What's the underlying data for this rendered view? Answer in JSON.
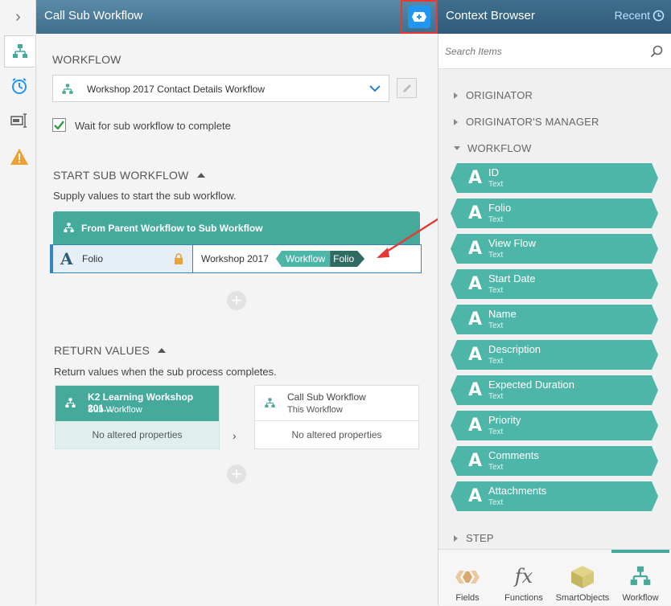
{
  "header": {
    "title": "Call Sub Workflow"
  },
  "context_browser": {
    "title": "Context Browser",
    "recent_label": "Recent",
    "search_placeholder": "Search Items",
    "sections": {
      "originator": "ORIGINATOR",
      "originators_manager": "ORIGINATOR'S MANAGER",
      "workflow": "WORKFLOW",
      "step": "STEP"
    },
    "items": [
      {
        "name": "ID",
        "type": "Text"
      },
      {
        "name": "Folio",
        "type": "Text"
      },
      {
        "name": "View Flow",
        "type": "Text"
      },
      {
        "name": "Start Date",
        "type": "Text"
      },
      {
        "name": "Name",
        "type": "Text"
      },
      {
        "name": "Description",
        "type": "Text"
      },
      {
        "name": "Expected Duration",
        "type": "Text"
      },
      {
        "name": "Priority",
        "type": "Text"
      },
      {
        "name": "Comments",
        "type": "Text"
      },
      {
        "name": "Attachments",
        "type": "Text"
      }
    ],
    "bottom_tabs": {
      "fields": "Fields",
      "functions": "Functions",
      "smartobjects": "SmartObjects",
      "workflow": "Workflow"
    }
  },
  "workflow": {
    "label": "WORKFLOW",
    "selected": "Workshop 2017 Contact Details Workflow",
    "wait_label": "Wait for sub workflow to complete",
    "wait_checked": true
  },
  "start_sub": {
    "label": "START SUB WORKFLOW",
    "desc": "Supply values to start the sub workflow.",
    "mapping_title": "From Parent Workflow to Sub Workflow",
    "field_name": "Folio",
    "value_text": "Workshop 2017",
    "token_source": "Workflow",
    "token_field": "Folio"
  },
  "return_values": {
    "label": "RETURN VALUES",
    "desc": "Return values when the sub process completes.",
    "left_title": "K2 Learning Workshop 201...",
    "left_subtitle": "Sub Workflow",
    "left_body": "No altered properties",
    "right_title": "Call Sub Workflow",
    "right_subtitle": "This Workflow",
    "right_body": "No altered properties"
  }
}
